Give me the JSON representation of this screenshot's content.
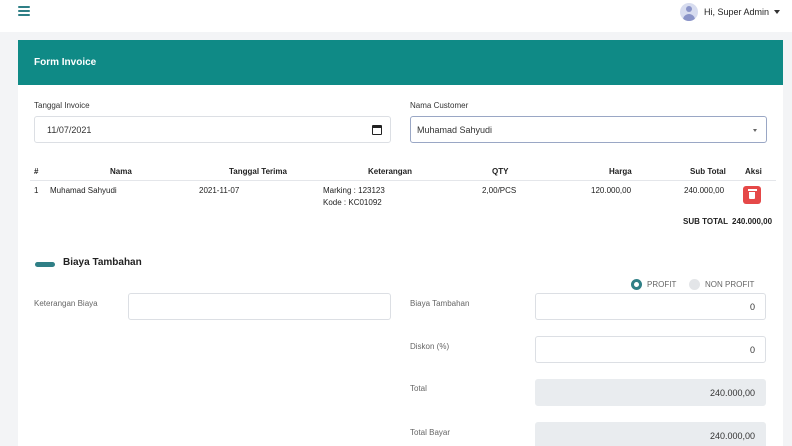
{
  "topbar": {
    "menu_icon": "hamburger-icon",
    "user_label": "Hi, Super Admin"
  },
  "card": {
    "title": "Form Invoice"
  },
  "form": {
    "invoice_date_label": "Tanggal Invoice",
    "invoice_date_value": "11/07/2021",
    "customer_label": "Nama Customer",
    "customer_value": "Muhamad Sahyudi"
  },
  "table": {
    "headers": [
      "#",
      "Nama",
      "Tanggal Terima",
      "Keterangan",
      "QTY",
      "Harga",
      "Sub Total",
      "Aksi"
    ],
    "rows": [
      {
        "no": "1",
        "nama": "Muhamad Sahyudi",
        "tanggal": "2021-11-07",
        "keterangan_1": "Marking : 123123",
        "keterangan_2": "Kode : KC01092",
        "qty": "2,00/PCS",
        "harga": "120.000,00",
        "subtotal": "240.000,00"
      }
    ],
    "subtotal_label": "SUB TOTAL",
    "subtotal_value": "240.000,00"
  },
  "extra": {
    "section_title": "Biaya Tambahan",
    "radio_profit": "PROFIT",
    "radio_nonprofit": "NON PROFIT",
    "selected": "PROFIT",
    "keterangan_label": "Keterangan Biaya",
    "keterangan_value": "",
    "biaya_label": "Biaya Tambahan",
    "biaya_value": "0",
    "diskon_label": "Diskon (%)",
    "diskon_value": "0",
    "total_label": "Total",
    "total_value": "240.000,00",
    "bayar_label": "Total Bayar",
    "bayar_value": "240.000,00"
  },
  "colors": {
    "primary": "#0f8a86",
    "danger": "#e54848",
    "accent": "#2f7f86"
  }
}
